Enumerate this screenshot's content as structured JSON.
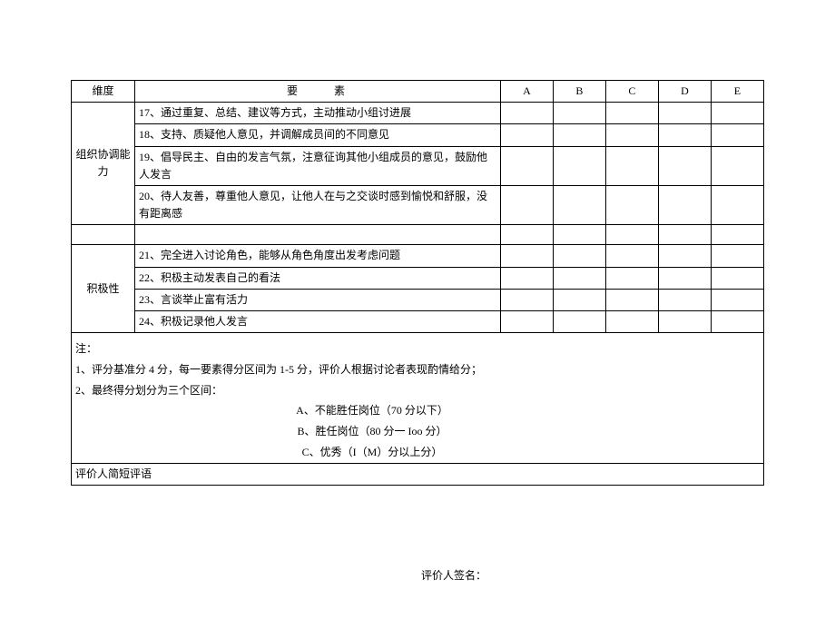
{
  "headers": {
    "dimension": "维度",
    "element": "要素",
    "cols": [
      "A",
      "B",
      "C",
      "D",
      "E"
    ]
  },
  "group1": {
    "dimension": "组织协调能力",
    "items": [
      "17、通过重复、总结、建议等方式，主动推动小组讨进展",
      "18、支持、质疑他人意见，并调解成员间的不同意见",
      "19、倡导民主、自由的发言气氛，注意征询其他小组成员的意见，鼓励他人发言",
      "20、待人友善，尊重他人意见，让他人在与之交谈时感到愉悦和舒服，没有距离感"
    ]
  },
  "group2": {
    "dimension": "积极性",
    "items": [
      "21、完全进入讨论角色，能够从角色角度出发考虑问题",
      "22、积极主动发表自己的看法",
      "23、言谈举止富有活力",
      "24、积极记录他人发言"
    ]
  },
  "notes": {
    "heading": "注：",
    "line1": "1、评分基准分 4 分，每一要素得分区间为 1-5 分，评价人根据讨论者表现酌情给分；",
    "line2": "2、最终得分划分为三个区间：",
    "a": "A、不能胜任岗位（70 分以下）",
    "b": "B、胜任岗位（80 分一 Ioo 分）",
    "c": "C、优秀（I（M）分以上分）"
  },
  "commentLabel": "评价人简短评语",
  "signatureLabel": "评价人签名："
}
